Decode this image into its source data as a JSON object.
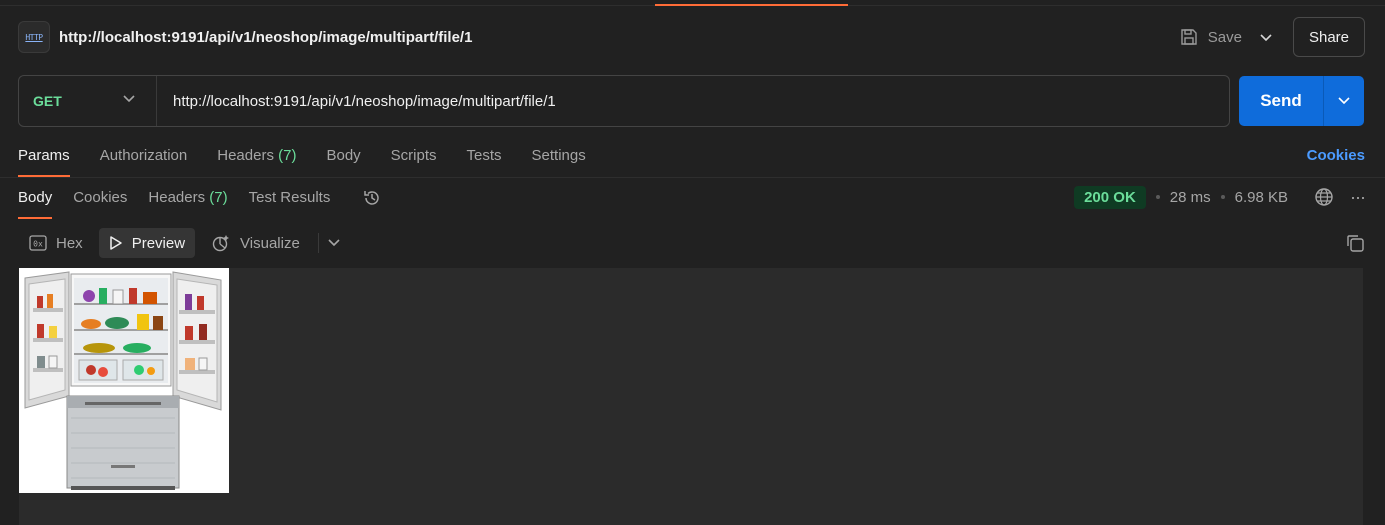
{
  "request": {
    "title": "http://localhost:9191/api/v1/neoshop/image/multipart/file/1",
    "icon": "http-icon",
    "icon_text": "HTTP",
    "method": "GET",
    "url": "http://localhost:9191/api/v1/neoshop/image/multipart/file/1"
  },
  "header_actions": {
    "save_label": "Save",
    "share_label": "Share"
  },
  "send": {
    "label": "Send"
  },
  "request_tabs": [
    {
      "label": "Params",
      "active": true
    },
    {
      "label": "Authorization"
    },
    {
      "label": "Headers",
      "count": "(7)"
    },
    {
      "label": "Body"
    },
    {
      "label": "Scripts"
    },
    {
      "label": "Tests"
    },
    {
      "label": "Settings"
    }
  ],
  "cookies_link": "Cookies",
  "response_tabs": [
    {
      "label": "Body",
      "active": true
    },
    {
      "label": "Cookies"
    },
    {
      "label": "Headers",
      "count": "(7)"
    },
    {
      "label": "Test Results"
    }
  ],
  "response_meta": {
    "status": "200 OK",
    "time": "28 ms",
    "size": "6.98 KB",
    "more": "···"
  },
  "view_modes": {
    "hex": "Hex",
    "preview": "Preview",
    "visualize": "Visualize",
    "active": "Preview"
  },
  "preview_image": {
    "subject": "refrigerator-image"
  },
  "colors": {
    "accent": "#ff6c37",
    "send": "#0f6cdb",
    "method_get": "#6bdd9a",
    "status_ok_bg": "#0f3b23",
    "link": "#4b9bff"
  }
}
